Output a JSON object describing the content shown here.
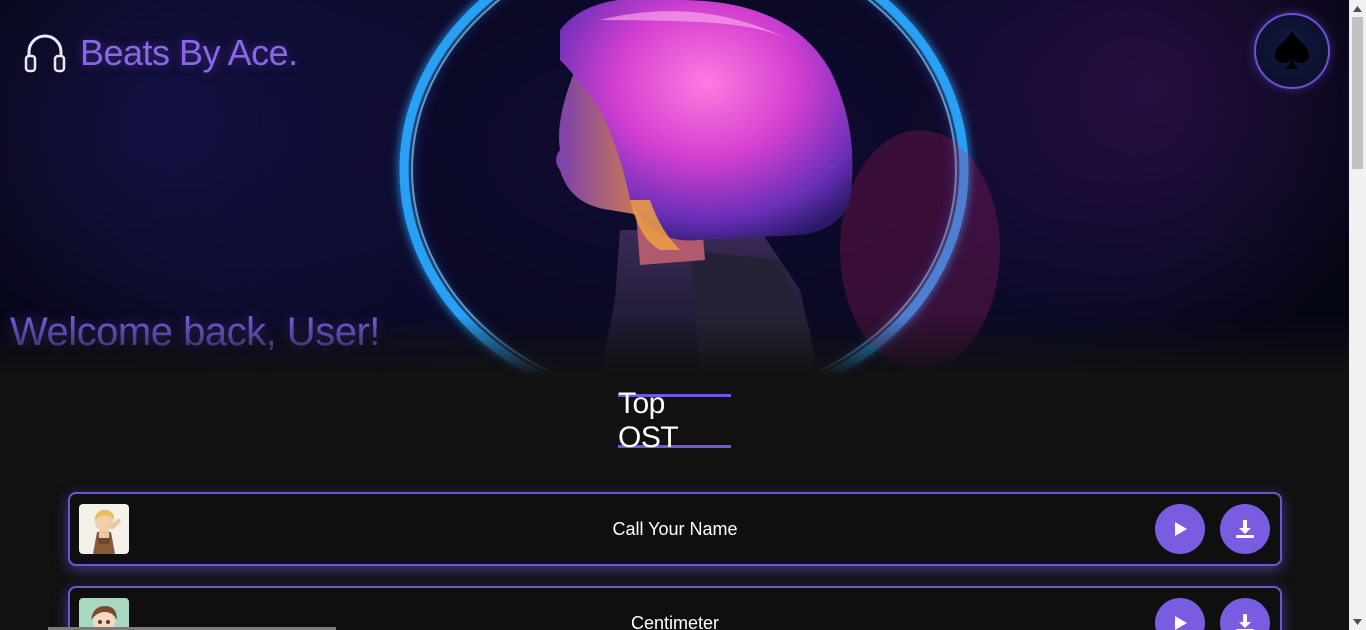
{
  "header": {
    "brand_name": "Beats By Ace.",
    "logo_icon": "headphones-icon",
    "profile_icon": "spade-icon"
  },
  "hero": {
    "welcome_text": "Welcome back, User!"
  },
  "section": {
    "title": "Top OST"
  },
  "tracks": [
    {
      "title": "Call Your Name",
      "thumb_icon": "anime-character-thumbnail",
      "play_icon": "play-icon",
      "download_icon": "download-icon"
    },
    {
      "title": "Centimeter",
      "thumb_icon": "anime-character-thumbnail",
      "play_icon": "play-icon",
      "download_icon": "download-icon"
    }
  ],
  "colors": {
    "accent": "#7a5ce0",
    "background": "#111111",
    "text": "#ffffff"
  }
}
